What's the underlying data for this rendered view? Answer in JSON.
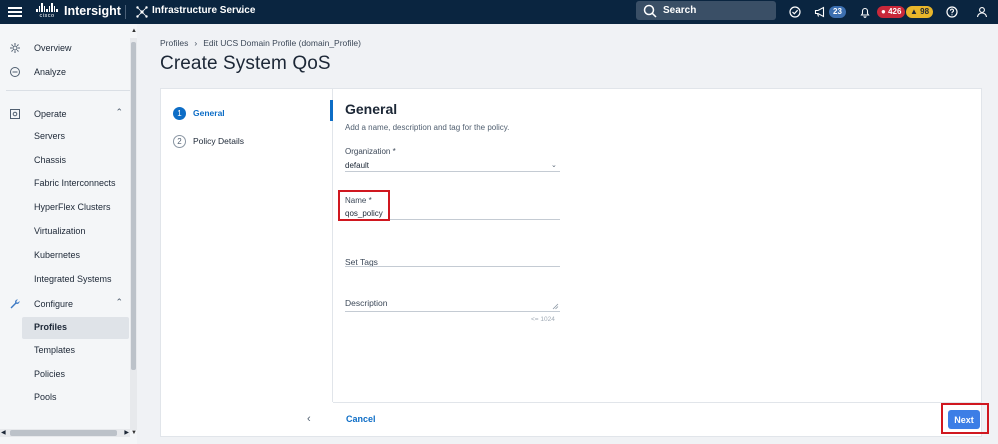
{
  "app": {
    "brand": "Intersight",
    "logo_text": "cisco",
    "service": "Infrastructure Service",
    "search_label": "Search",
    "counts": {
      "announcements": "23",
      "critical": "426",
      "warnings": "98"
    }
  },
  "sidebar": {
    "items": [
      {
        "label": "Overview",
        "icon": "overview-icon"
      },
      {
        "label": "Analyze",
        "icon": "analyze-icon"
      },
      {
        "label": "Operate",
        "icon": "operate-icon"
      },
      {
        "label": "Servers"
      },
      {
        "label": "Chassis"
      },
      {
        "label": "Fabric Interconnects"
      },
      {
        "label": "HyperFlex Clusters"
      },
      {
        "label": "Virtualization"
      },
      {
        "label": "Kubernetes"
      },
      {
        "label": "Integrated Systems"
      },
      {
        "label": "Configure",
        "icon": "wrench-icon"
      },
      {
        "label": "Profiles",
        "active": true
      },
      {
        "label": "Templates"
      },
      {
        "label": "Policies"
      },
      {
        "label": "Pools"
      }
    ]
  },
  "breadcrumb": {
    "parent": "Profiles",
    "current": "Edit UCS Domain Profile (domain_Profile)"
  },
  "page_title": "Create System QoS",
  "steps": [
    {
      "num": "1",
      "label": "General",
      "active": true
    },
    {
      "num": "2",
      "label": "Policy Details",
      "active": false
    }
  ],
  "form": {
    "title": "General",
    "subtitle": "Add a name, description and tag for the policy.",
    "organization": {
      "label": "Organization *",
      "value": "default"
    },
    "name": {
      "label": "Name *",
      "value": "qos_policy"
    },
    "tags": {
      "label": "Set Tags"
    },
    "description": {
      "label": "Description",
      "counter": "<= 1024"
    }
  },
  "footer": {
    "cancel": "Cancel",
    "next": "Next"
  },
  "colors": {
    "accent": "#0d6dc6",
    "topbar": "#0a2540",
    "highlight": "#d0171f"
  }
}
